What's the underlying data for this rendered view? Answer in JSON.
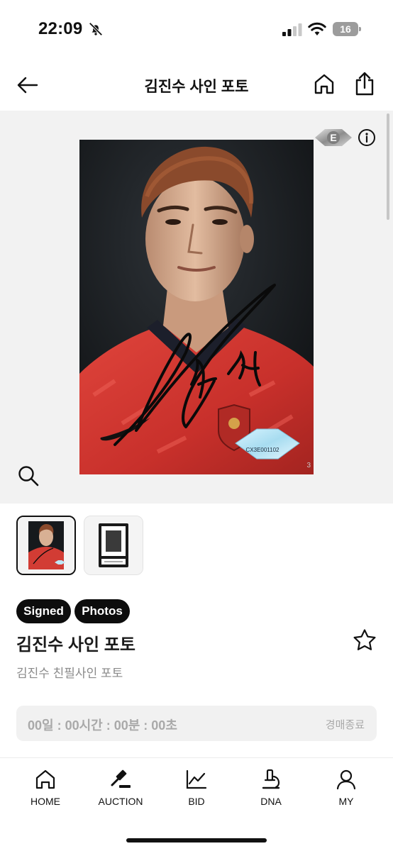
{
  "status_bar": {
    "time": "22:09",
    "battery": "16"
  },
  "header": {
    "title": "김진수 사인 포토"
  },
  "viewer": {
    "grade_badge": "E",
    "cert_number": "CX3E001102",
    "edge_mark": "3"
  },
  "thumbnails": [
    {
      "label": "signed-photo-front"
    },
    {
      "label": "slab-case"
    }
  ],
  "product": {
    "tags": [
      "Signed",
      "Photos"
    ],
    "title": "김진수 사인 포토",
    "subtitle": "김진수 친필사인 포토"
  },
  "auction": {
    "countdown": "00일 : 00시간 : 00분 : 00초",
    "status": "경매종료"
  },
  "bottom_nav": [
    {
      "label": "HOME",
      "icon": "home-icon"
    },
    {
      "label": "AUCTION",
      "icon": "gavel-icon"
    },
    {
      "label": "BID",
      "icon": "chart-icon"
    },
    {
      "label": "DNA",
      "icon": "microscope-icon"
    },
    {
      "label": "MY",
      "icon": "user-icon"
    }
  ],
  "colors": {
    "accent": "#0d0d0d",
    "viewer_bg": "#f2f2f2",
    "jersey_red": "#d83a34",
    "muted_text": "#a9a9a9"
  }
}
